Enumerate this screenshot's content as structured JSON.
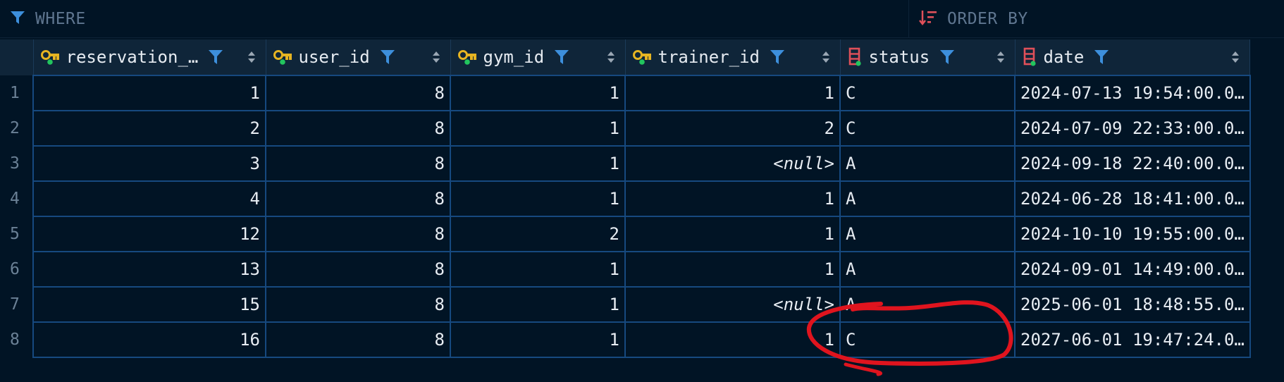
{
  "filter_bar": {
    "where_label": "WHERE",
    "order_by_label": "ORDER BY"
  },
  "columns": [
    {
      "name": "reservation_…",
      "key": "reservation_id",
      "icon": "primary-key-icon",
      "type": "key"
    },
    {
      "name": "user_id",
      "key": "user_id",
      "icon": "foreign-key-icon",
      "type": "key"
    },
    {
      "name": "gym_id",
      "key": "gym_id",
      "icon": "foreign-key-icon",
      "type": "key"
    },
    {
      "name": "trainer_id",
      "key": "trainer_id",
      "icon": "foreign-key-icon",
      "type": "key"
    },
    {
      "name": "status",
      "key": "status",
      "icon": "column-icon",
      "type": "column"
    },
    {
      "name": "date",
      "key": "date",
      "icon": "column-icon",
      "type": "column"
    }
  ],
  "rows": [
    {
      "n": "1",
      "reservation_id": "1",
      "user_id": "8",
      "gym_id": "1",
      "trainer_id": "1",
      "status": "C",
      "date": "2024-07-13 19:54:00.0…"
    },
    {
      "n": "2",
      "reservation_id": "2",
      "user_id": "8",
      "gym_id": "1",
      "trainer_id": "2",
      "status": "C",
      "date": "2024-07-09 22:33:00.0…"
    },
    {
      "n": "3",
      "reservation_id": "3",
      "user_id": "8",
      "gym_id": "1",
      "trainer_id": "<null>",
      "status": "A",
      "date": "2024-09-18 22:40:00.0…"
    },
    {
      "n": "4",
      "reservation_id": "4",
      "user_id": "8",
      "gym_id": "1",
      "trainer_id": "1",
      "status": "A",
      "date": "2024-06-28 18:41:00.0…"
    },
    {
      "n": "5",
      "reservation_id": "12",
      "user_id": "8",
      "gym_id": "2",
      "trainer_id": "1",
      "status": "A",
      "date": "2024-10-10 19:55:00.0…"
    },
    {
      "n": "6",
      "reservation_id": "13",
      "user_id": "8",
      "gym_id": "1",
      "trainer_id": "1",
      "status": "A",
      "date": "2024-09-01 14:49:00.0…"
    },
    {
      "n": "7",
      "reservation_id": "15",
      "user_id": "8",
      "gym_id": "1",
      "trainer_id": "<null>",
      "status": "A",
      "date": "2025-06-01 18:48:55.0…"
    },
    {
      "n": "8",
      "reservation_id": "16",
      "user_id": "8",
      "gym_id": "1",
      "trainer_id": "1",
      "status": "C",
      "date": "2027-06-01 19:47:24.0…"
    }
  ],
  "colors": {
    "background": "#011425",
    "header_bg": "#0f2539",
    "grid_border": "#16497f",
    "filter_blue": "#3d8fdc",
    "key_gold": "#e6b422",
    "column_icon_red": "#e0505a",
    "annotation_red": "#e0141e"
  }
}
